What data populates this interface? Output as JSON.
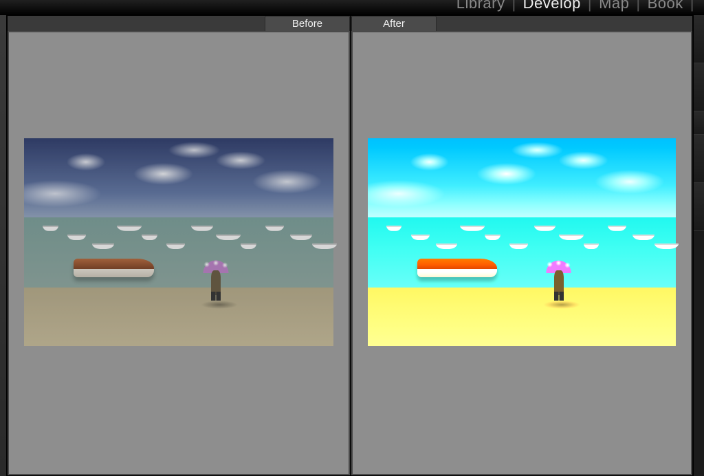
{
  "module_nav": {
    "items": [
      {
        "label": "Library",
        "active": false
      },
      {
        "label": "Develop",
        "active": true
      },
      {
        "label": "Map",
        "active": false
      },
      {
        "label": "Book",
        "active": false
      }
    ],
    "separator": "|"
  },
  "compare": {
    "left_label": "Before",
    "right_label": "After"
  },
  "scene": {
    "description": "Beach with boats in a bay; person walking with a purple polka-dot umbrella; orange wooden boat in foreground.",
    "elements": [
      "sky",
      "clouds",
      "water",
      "boats",
      "big-boat",
      "sand",
      "person",
      "umbrella",
      "shadow"
    ],
    "boats_x_pct": [
      6,
      14,
      22,
      30,
      38,
      46,
      54,
      62,
      70,
      78,
      86,
      93
    ],
    "bigboat_color": "#c9642a",
    "umbrella_color": "#c77bd6"
  },
  "colors": {
    "before": {
      "sky_top": "#2a3d7d",
      "sky_bot": "#8da4c8",
      "water": "#71a09a",
      "sand": "#b7a97e"
    },
    "after": {
      "sky_top": "#1fa7f0",
      "sky_bot": "#bfefff",
      "water": "#49d6d0",
      "sand": "#f5df7e"
    }
  }
}
